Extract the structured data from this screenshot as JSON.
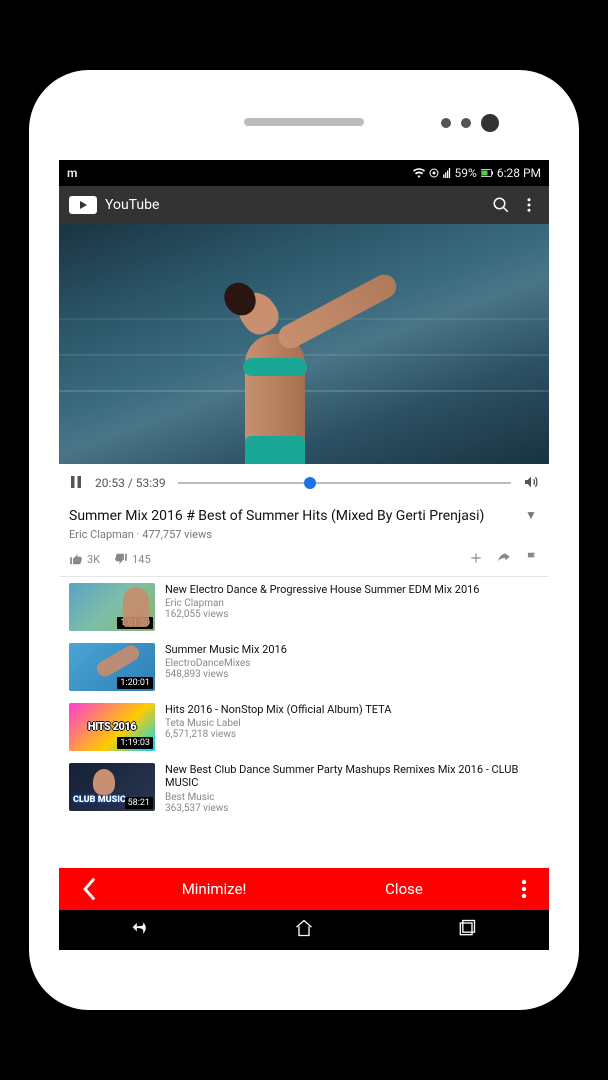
{
  "statusbar": {
    "app_letter": "m",
    "battery": "59%",
    "time": "6:28 PM"
  },
  "header": {
    "app_name": "YouTube"
  },
  "playbar": {
    "current": "20:53",
    "total": "53:39"
  },
  "video": {
    "title": "Summer Mix 2016 # Best of Summer Hits (Mixed By Gerti Prenjasi)",
    "channel": "Eric Clapman",
    "views": "477,757 views",
    "likes": "3K",
    "dislikes": "145"
  },
  "suggested": [
    {
      "title": "New Electro Dance & Progressive House Summer EDM Mix 2016",
      "channel": "Eric Clapman",
      "views": "162,055 views",
      "duration": "1:01:50"
    },
    {
      "title": "Summer Music Mix 2016",
      "channel": "ElectroDanceMixes",
      "views": "548,893 views",
      "duration": "1:20:01"
    },
    {
      "title": "Hits 2016 - NonStop Mix (Official Album) TETA",
      "channel": "Teta Music Label",
      "views": "6,571,218 views",
      "duration": "1:19:03"
    },
    {
      "title": "New Best Club Dance Summer Party Mashups Remixes Mix 2016 - CLUB MUSIC",
      "channel": "Best Music",
      "views": "363,537 views",
      "duration": "58:21"
    }
  ],
  "thumb_overlay": {
    "hits": "HITS 2016",
    "club": "CLUB MUSIC"
  },
  "footer": {
    "minimize": "Minimize!",
    "close": "Close"
  }
}
